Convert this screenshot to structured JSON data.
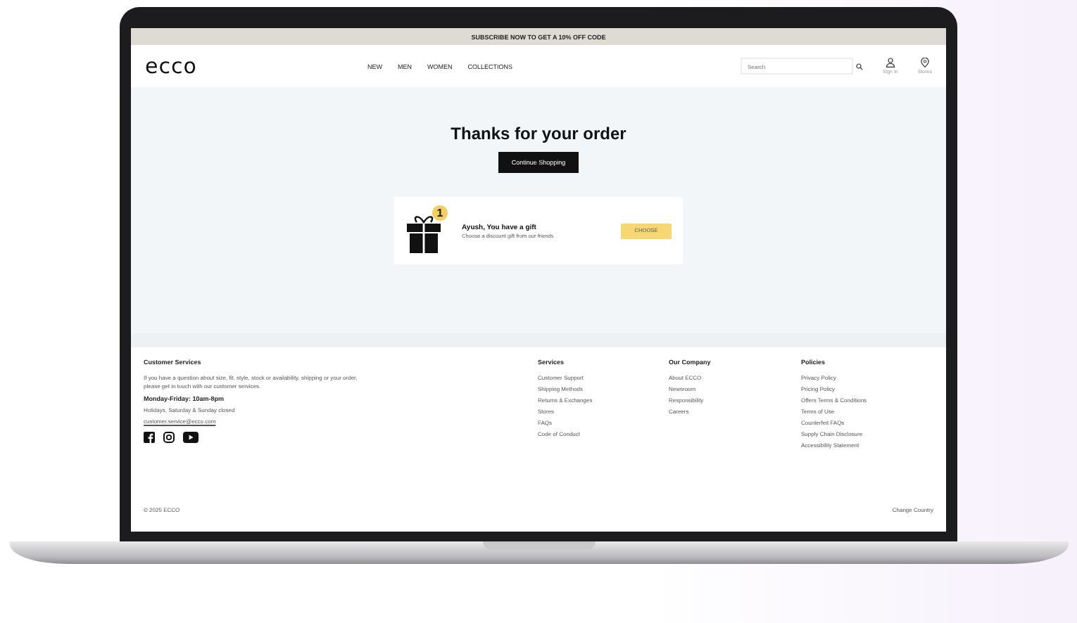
{
  "promo_banner": {
    "text": "SUBSCRIBE NOW TO GET A 10% OFF CODE"
  },
  "header": {
    "logo": "ecco",
    "nav": [
      "NEW",
      "MEN",
      "WOMEN",
      "COLLECTIONS"
    ],
    "search": {
      "placeholder": "Search"
    },
    "actions": [
      {
        "kind": "account",
        "label": "Sign In"
      },
      {
        "kind": "store",
        "label": "Stores"
      }
    ]
  },
  "confirmation": {
    "title": "Thanks for your order",
    "button": "Continue Shopping"
  },
  "gift": {
    "badge": "1",
    "title": "Ayush, You have a gift",
    "subtitle": "Choose a discount gift from our friends",
    "button": "CHOOSE"
  },
  "footer": {
    "customer_service": {
      "heading": "Customer Services",
      "text": "If you have a question about size, fit, style, stock or availability, shipping or your order, please get in touch with our customer services.",
      "hours": "Monday-Friday: 10am-8pm",
      "closed": "Holidays, Saturday & Sunday closed",
      "email": "customer.service@ecco.com",
      "social": [
        {
          "kind": "facebook"
        },
        {
          "kind": "instagram"
        },
        {
          "kind": "youtube"
        }
      ]
    },
    "columns": [
      {
        "heading": "Services",
        "links": [
          "Customer Support",
          "Shipping Methods",
          "Returns & Exchanges",
          "Stores",
          "FAQs",
          "Code of Conduct"
        ]
      },
      {
        "heading": "Our Company",
        "links": [
          "About ECCO",
          "Newsroom",
          "Responsibility",
          "Careers"
        ]
      },
      {
        "heading": "Policies",
        "links": [
          "Privacy Policy",
          "Pricing Policy",
          "Offers Terms & Conditions",
          "Terms of Use",
          "Counterfeit FAQs",
          "Supply Chain Disclosure",
          "Accessibility Statement"
        ]
      }
    ],
    "copyright": "© 2025 ECCO",
    "country": "Change Country"
  }
}
